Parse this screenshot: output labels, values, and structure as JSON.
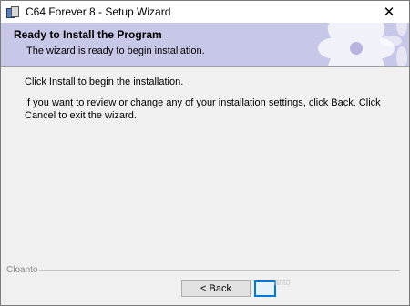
{
  "window": {
    "title": "C64 Forever 8 - Setup Wizard",
    "close_glyph": "✕"
  },
  "banner": {
    "title": "Ready to Install the Program",
    "subtitle": "The wizard is ready to begin installation.",
    "background_color": "#c7c7e8"
  },
  "content": {
    "line1": "Click Install to begin the installation.",
    "line2": "If you want to review or change any of your installation settings, click Back. Click Cancel to exit the wizard."
  },
  "footer": {
    "brand": "Cloanto",
    "back_label": "< Back",
    "next_label": "",
    "ghost_text": "anto"
  },
  "colors": {
    "accent": "#0078d7"
  }
}
